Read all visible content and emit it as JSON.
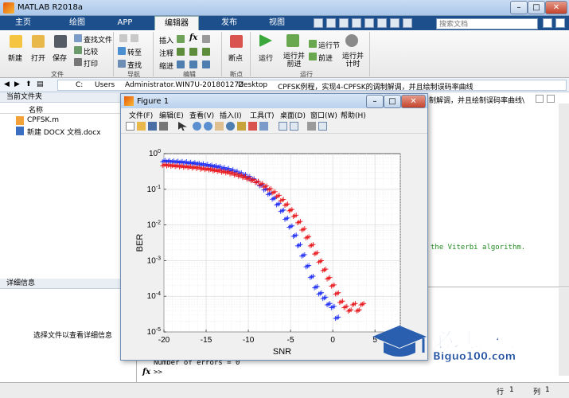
{
  "window": {
    "title": "MATLAB R2018a",
    "min": "–",
    "max": "□",
    "close": "✕"
  },
  "tabs": [
    {
      "label": "主页"
    },
    {
      "label": "绘图"
    },
    {
      "label": "APP"
    },
    {
      "label": "编辑器"
    },
    {
      "label": "发布"
    },
    {
      "label": "视图"
    }
  ],
  "search": {
    "placeholder": "搜索文档"
  },
  "ribbon": {
    "file": {
      "new": "新建",
      "open": "打开",
      "save": "保存",
      "find_files": "查找文件",
      "compare": "比较",
      "print": "打印",
      "group": "文件"
    },
    "navigate": {
      "goto": "转至",
      "find": "查找",
      "group": "导航"
    },
    "edit": {
      "insert": "插入",
      "comment": "注释",
      "indent": "缩进",
      "fx": "fx",
      "group": "编辑"
    },
    "breakpoints": {
      "breakpoints": "断点",
      "group": "断点"
    },
    "run": {
      "run": "运行",
      "run_advance": "运行并\n前进",
      "run_section": "运行节",
      "advance": "前进",
      "run_time": "运行并\n计时",
      "group": "运行"
    }
  },
  "address": {
    "segments": [
      "C:",
      "Users",
      "Administrator.WIN7U-20180127Z",
      "Desktop",
      "CPFSK例程，实现4-CPFSK的调制解调，并且绘制误码率曲线"
    ]
  },
  "current_folder": {
    "header": "当前文件夹",
    "column": "名称",
    "files": [
      {
        "name": "CPFSK.m"
      },
      {
        "name": "新建 DOCX 文档.docx"
      }
    ]
  },
  "details": {
    "header": "详细信息",
    "empty_text": "选择文件以查看详细信息"
  },
  "command_window": {
    "right_title": "制解调，并且绘制误码率曲线\\",
    "line_viterbi": "the Viterbi algorithm.",
    "errors_line": "Number of errors = 0",
    "prompt": ">>"
  },
  "status": {
    "row_label": "行",
    "row": "1",
    "col_label": "列",
    "col": "1"
  },
  "figure": {
    "title": "Figure 1",
    "menu": [
      "文件(F)",
      "编辑(E)",
      "查看(V)",
      "插入(I)",
      "工具(T)",
      "桌面(D)",
      "窗口(W)",
      "帮助(H)"
    ]
  },
  "watermark": {
    "big": "必过源码",
    "small": "Biguo100.com"
  },
  "colors": {
    "blue": "#1f2ef5",
    "red": "#e8171c",
    "ribbon_tab": "#1d4f8c"
  },
  "chart_data": {
    "type": "scatter",
    "xlabel": "SNR",
    "ylabel": "BER",
    "xlim": [
      -20,
      8
    ],
    "ylim": [
      1e-05,
      1
    ],
    "yscale": "log",
    "grid": true,
    "xticks": [
      "-20",
      "-15",
      "-10",
      "-5",
      "0",
      "5"
    ],
    "yticks": [
      "10^0",
      "10^-1",
      "10^-2",
      "10^-3",
      "10^-4",
      "10^-5"
    ],
    "series": [
      {
        "color": "#1f2ef5",
        "marker": "+",
        "x": [
          -20,
          -19.5,
          -19,
          -18.5,
          -18,
          -17.5,
          -17,
          -16.5,
          -16,
          -15.5,
          -15,
          -14.5,
          -14,
          -13.5,
          -13,
          -12.5,
          -12,
          -11.5,
          -11,
          -10.5,
          -10,
          -9.5,
          -9,
          -8.5,
          -8,
          -7.5,
          -7,
          -6.5,
          -6,
          -5.5,
          -5,
          -4.5,
          -4,
          -3.5,
          -3,
          -2.5,
          -2,
          -1.5,
          -1,
          -0.5,
          0,
          0.5
        ],
        "y": [
          0.62,
          0.61,
          0.6,
          0.59,
          0.58,
          0.57,
          0.55,
          0.54,
          0.52,
          0.5,
          0.48,
          0.46,
          0.44,
          0.42,
          0.39,
          0.37,
          0.34,
          0.31,
          0.28,
          0.25,
          0.22,
          0.19,
          0.16,
          0.13,
          0.1,
          0.075,
          0.055,
          0.038,
          0.025,
          0.015,
          0.009,
          0.005,
          0.0027,
          0.0014,
          0.0007,
          0.00035,
          0.00018,
          0.00012,
          9e-05,
          6e-05,
          5e-05,
          2.5e-05
        ]
      },
      {
        "color": "#e8171c",
        "marker": "+",
        "x": [
          -20,
          -19.5,
          -19,
          -18.5,
          -18,
          -17.5,
          -17,
          -16.5,
          -16,
          -15.5,
          -15,
          -14.5,
          -14,
          -13.5,
          -13,
          -12.5,
          -12,
          -11.5,
          -11,
          -10.5,
          -10,
          -9.5,
          -9,
          -8.5,
          -8,
          -7.5,
          -7,
          -6.5,
          -6,
          -5.5,
          -5,
          -4.5,
          -4,
          -3.5,
          -3,
          -2.5,
          -2,
          -1.5,
          -1,
          -0.5,
          0,
          0.5,
          1,
          1.5,
          2,
          2.5,
          3,
          3.5
        ],
        "y": [
          0.48,
          0.47,
          0.46,
          0.45,
          0.44,
          0.43,
          0.42,
          0.41,
          0.4,
          0.38,
          0.37,
          0.36,
          0.34,
          0.33,
          0.31,
          0.3,
          0.28,
          0.26,
          0.24,
          0.22,
          0.2,
          0.18,
          0.16,
          0.14,
          0.12,
          0.1,
          0.082,
          0.065,
          0.05,
          0.037,
          0.026,
          0.018,
          0.012,
          0.0075,
          0.0045,
          0.0027,
          0.0016,
          0.00095,
          0.00055,
          0.00032,
          0.0002,
          0.00012,
          7e-05,
          5e-05,
          4e-05,
          6e-05,
          4e-05,
          6e-05
        ]
      }
    ]
  }
}
